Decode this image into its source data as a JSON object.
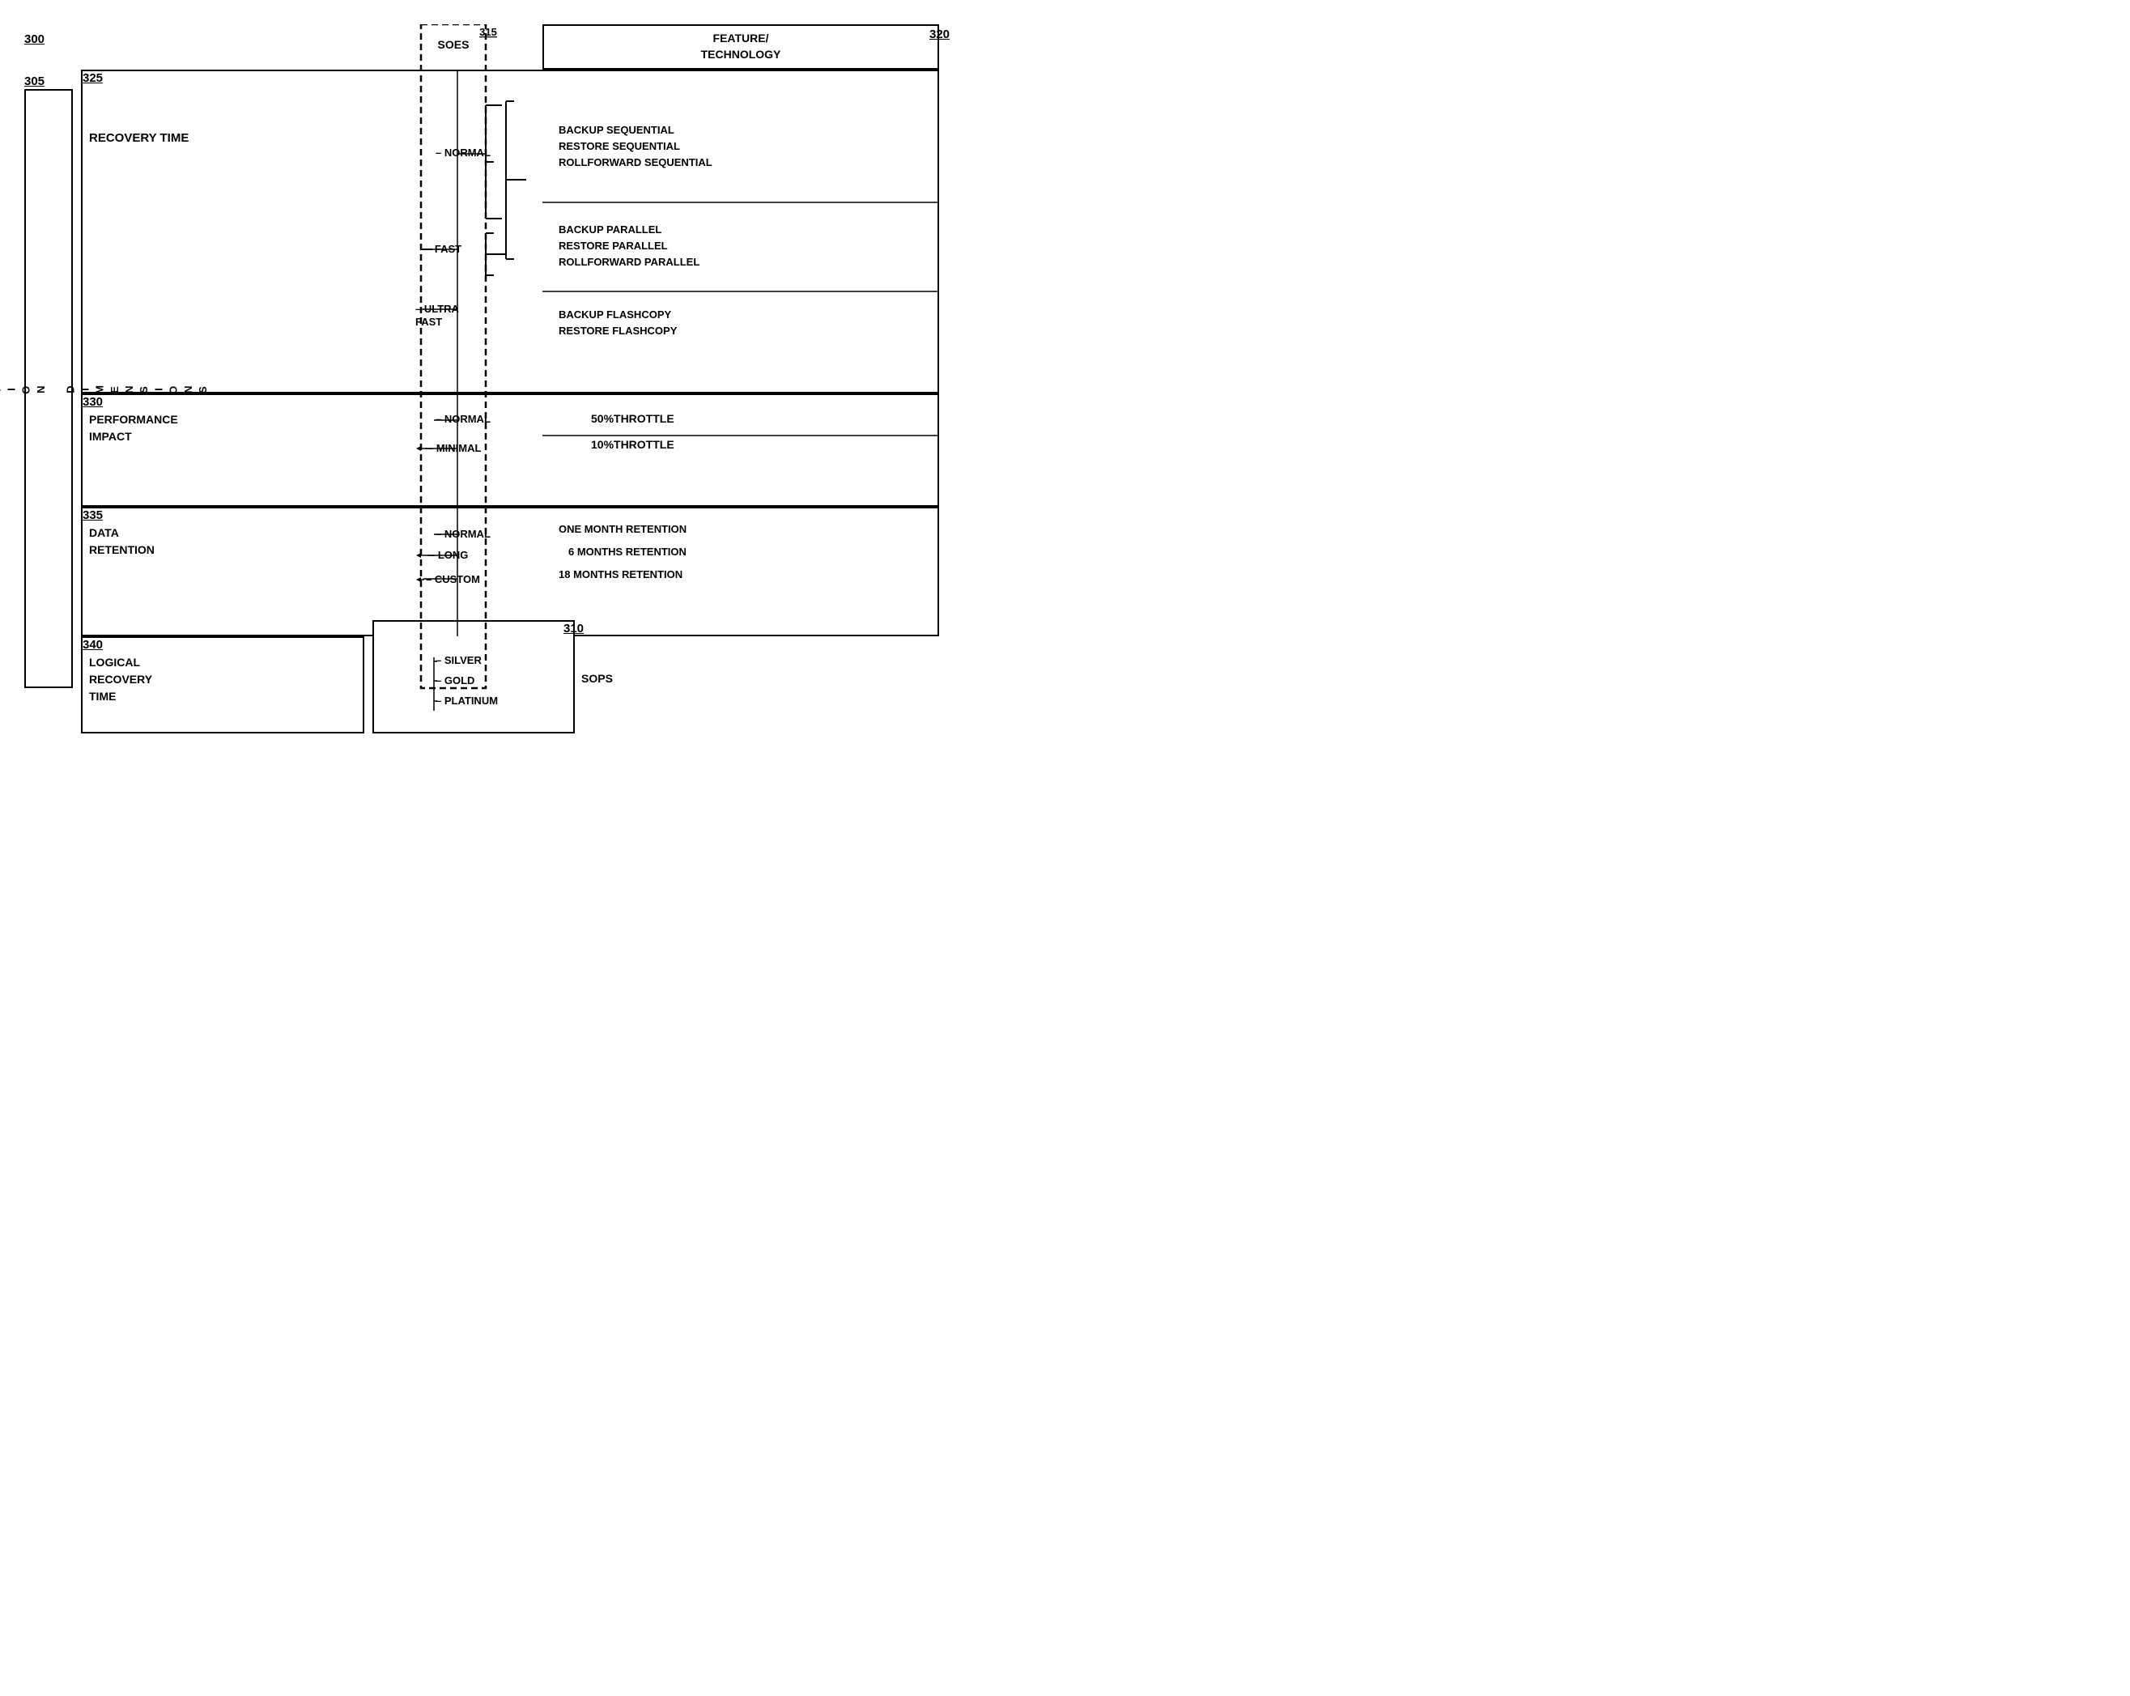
{
  "diagram": {
    "title_ref": "300",
    "app_dim_ref": "305",
    "app_dim_text": "A P P L I C A T I O N   D I M E N S I O N S",
    "soes_label": "SOES",
    "soes_ref": "315",
    "feature_header": "FEATURE/\nTECHNOLOGY",
    "feature_ref": "320",
    "sops_ref": "310",
    "sops_label": "SOPS",
    "sections": {
      "s325": {
        "ref": "325",
        "label": "RECOVERY TIME",
        "levels": [
          {
            "name": "NORMAL",
            "features": [
              "BACKUP SEQUENTIAL",
              "RESTORE SEQUENTIAL",
              "ROLLFORWARD SEQUENTIAL"
            ]
          },
          {
            "name": "FAST",
            "features": [
              "BACKUP PARALLEL",
              "RESTORE PARALLEL",
              "ROLLFORWARD PARALLEL"
            ]
          },
          {
            "name": "ULTRA\nFAST",
            "features": [
              "BACKUP FLASHCOPY",
              "RESTORE FLASHCOPY"
            ]
          }
        ]
      },
      "s330": {
        "ref": "330",
        "label": "PERFORMANCE\nIMPACT",
        "levels": [
          {
            "name": "NORMAL",
            "features": [
              "50%THROTTLE"
            ]
          },
          {
            "name": "MINIMAL",
            "features": [
              "10%THROTTLE"
            ]
          }
        ]
      },
      "s335": {
        "ref": "335",
        "label": "DATA\nRETENTION",
        "levels": [
          {
            "name": "NORMAL",
            "features": [
              "ONE MONTH RETENTION"
            ]
          },
          {
            "name": "LONG",
            "features": [
              "6 MONTHS RETENTION"
            ]
          },
          {
            "name": "CUSTOM",
            "features": [
              "18 MONTHS RETENTION"
            ]
          }
        ]
      },
      "s340": {
        "ref": "340",
        "label": "LOGICAL\nRECOVERY\nTIME",
        "levels": [
          {
            "name": "SILVER"
          },
          {
            "name": "GOLD"
          },
          {
            "name": "PLATINUM"
          }
        ]
      }
    }
  }
}
